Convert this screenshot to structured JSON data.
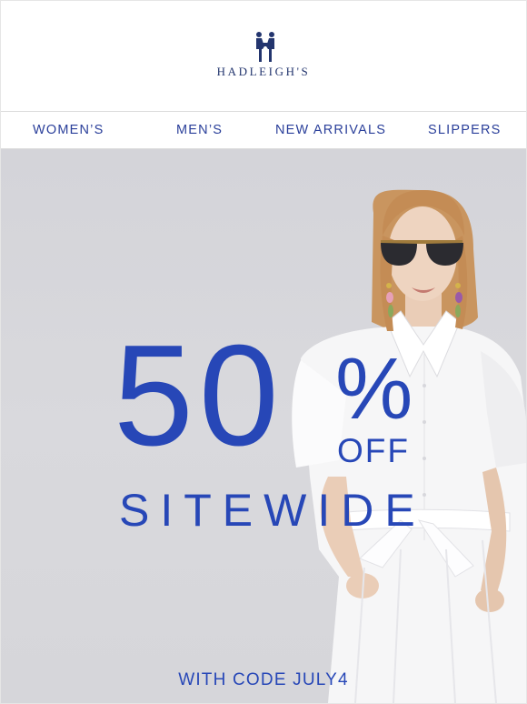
{
  "brand": {
    "name": "HADLEIGH'S",
    "accent": "#2747b7",
    "navy": "#23356e"
  },
  "nav": {
    "items": [
      {
        "label": "WOMEN’S"
      },
      {
        "label": "MEN’S"
      },
      {
        "label": "NEW ARRIVALS"
      },
      {
        "label": "SLIPPERS"
      }
    ]
  },
  "promo": {
    "amount": "50",
    "percent_sign": "%",
    "off": "OFF",
    "scope": "SITEWIDE",
    "code_line": "WITH CODE JULY4"
  }
}
